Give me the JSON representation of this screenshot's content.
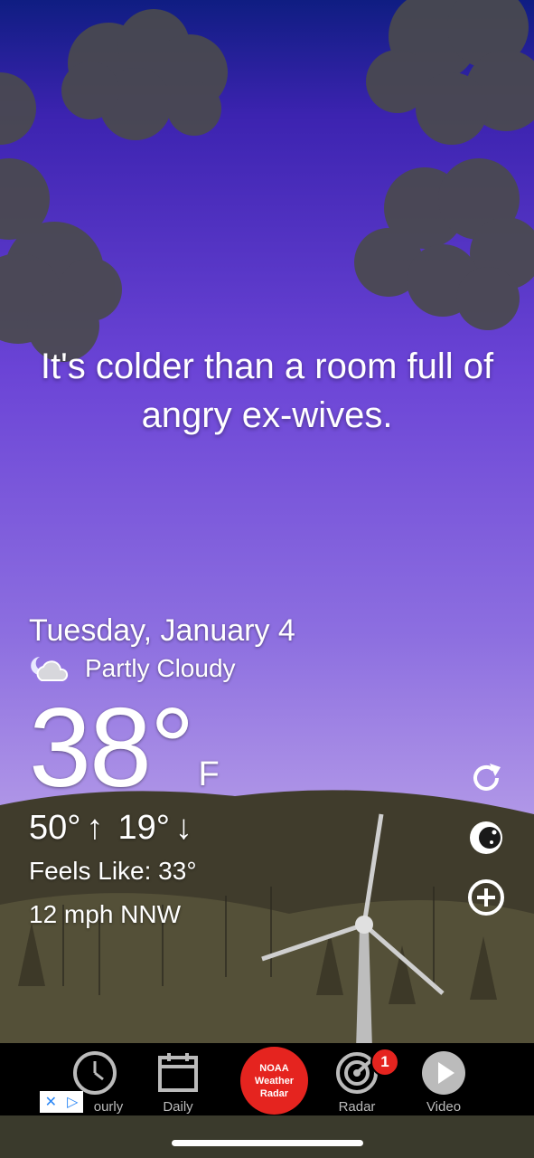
{
  "quote": "It's colder than a room full of angry ex-wives.",
  "weather": {
    "date": "Tuesday, January 4",
    "condition": "Partly Cloudy",
    "condition_icon": "partly-cloudy-night-icon",
    "temperature": "38°",
    "unit": "F",
    "high": "50°",
    "low": "19°",
    "feels_like": "Feels Like: 33°",
    "wind": "12 mph NNW"
  },
  "side_actions": [
    {
      "name": "refresh-icon"
    },
    {
      "name": "night-mode-icon"
    },
    {
      "name": "add-location-icon"
    }
  ],
  "nav": {
    "hourly": "ourly",
    "daily": "Daily",
    "noaa": "NOAA Weather Radar",
    "radar": "Radar",
    "radar_badge": "1",
    "video": "Video"
  },
  "colors": {
    "noaa_red": "#e5241f",
    "sky_top": "#0f1d82",
    "sky_mid": "#6b44d6",
    "sky_low": "#c3b0ee"
  }
}
